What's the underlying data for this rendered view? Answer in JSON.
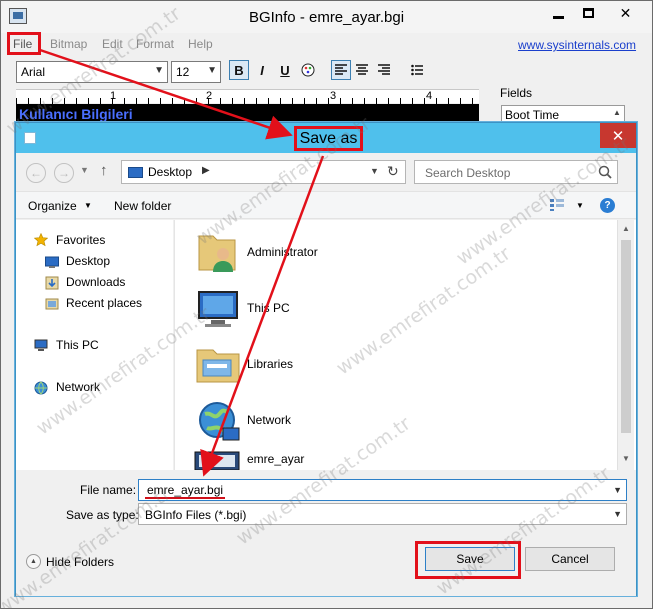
{
  "back_window": {
    "title": "BGInfo - emre_ayar.bgi",
    "menu": [
      "File",
      "Bitmap",
      "Edit",
      "Format",
      "Help"
    ],
    "link": "www.sysinternals.com",
    "font_name": "Arial",
    "font_size": "12",
    "toolbar": {
      "bold": "B",
      "italic": "I",
      "underline": "U"
    },
    "ruler_numbers": [
      "1",
      "2",
      "3",
      "4"
    ],
    "editor_text": "Kullanıcı Bilgileri",
    "fields_label": "Fields",
    "fields_item": "Boot Time"
  },
  "dialog": {
    "title": "Save as",
    "address": "Desktop",
    "search_placeholder": "Search Desktop",
    "organize": "Organize",
    "new_folder": "New folder",
    "nav": {
      "favorites": "Favorites",
      "desktop": "Desktop",
      "downloads": "Downloads",
      "recent_places": "Recent places",
      "this_pc": "This PC",
      "network": "Network"
    },
    "files": [
      "Administrator",
      "This PC",
      "Libraries",
      "Network",
      "emre_ayar"
    ],
    "file_name_label": "File name:",
    "file_name_value": "emre_ayar.bgi",
    "save_type_label": "Save as type:",
    "save_type_value": "BGInfo Files (*.bgi)",
    "hide_folders": "Hide Folders",
    "save": "Save",
    "cancel": "Cancel"
  },
  "watermark": "www.emrefirat.com.tr",
  "colors": {
    "dialog_title_bg": "#4fc0ec",
    "annotation_red": "#e2101a",
    "close_red": "#c7372f",
    "editor_text": "#4a6fff"
  }
}
